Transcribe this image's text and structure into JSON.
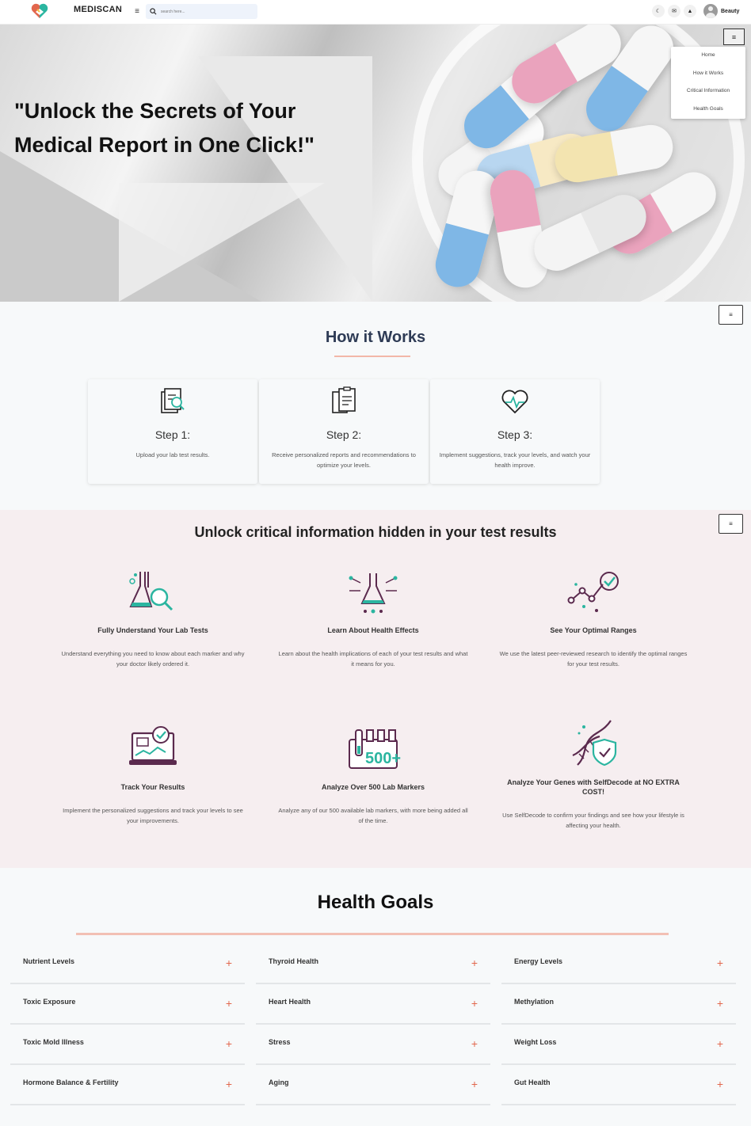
{
  "header": {
    "brand": "MEDISCAN",
    "menu_icon": "hamburger-icon",
    "search_placeholder": "search here...",
    "icons": [
      "moon-icon",
      "mail-icon",
      "bell-icon"
    ],
    "user_name": "Beauty"
  },
  "hero": {
    "title": "\"Unlock the Secrets of Your Medical Report in One Click!\"",
    "menu_button": "≡",
    "dropdown": [
      "Home",
      "How it Works",
      "Critical Information",
      "Health Goals"
    ]
  },
  "how_it_works": {
    "title": "How it Works",
    "menu_button": "≡",
    "steps": [
      {
        "title": "Step 1:",
        "desc": "Upload your lab test results.",
        "icon": "document-search-icon"
      },
      {
        "title": "Step 2:",
        "desc": "Receive personalized reports and recommendations to optimize your levels.",
        "icon": "clipboard-icon"
      },
      {
        "title": "Step 3:",
        "desc": "Implement suggestions, track your levels, and watch your health improve.",
        "icon": "heartbeat-icon"
      }
    ]
  },
  "unlock": {
    "title": "Unlock critical information hidden in your test results",
    "menu_button": "≡",
    "features": [
      {
        "title": "Fully Understand Your Lab Tests",
        "desc": "Understand everything you need to know about each marker and why your doctor likely ordered it.",
        "icon": "flask-magnifier-icon"
      },
      {
        "title": "Learn About Health Effects",
        "desc": "Learn about the health implications of each of your test results and what it means for you.",
        "icon": "flask-network-icon"
      },
      {
        "title": "See Your Optimal Ranges",
        "desc": "We use the latest peer-reviewed research to identify the optimal ranges for your test results.",
        "icon": "range-check-icon"
      },
      {
        "title": "Track Your Results",
        "desc": "Implement the personalized suggestions and track your levels to see your improvements.",
        "icon": "laptop-chart-icon"
      },
      {
        "title": "Analyze Over 500 Lab Markers",
        "desc": "Analyze any of our 500 available lab markers, with more being added all of the time.",
        "icon": "test-tubes-500-icon"
      },
      {
        "title": "Analyze Your Genes with SelfDecode at NO EXTRA COST!",
        "desc": "Use SelfDecode to confirm your findings and see how your lifestyle is affecting your health.",
        "icon": "dna-shield-icon"
      }
    ]
  },
  "health_goals": {
    "title": "Health Goals",
    "columns": [
      [
        "Nutrient Levels",
        "Toxic Exposure",
        "Toxic Mold Illness",
        "Hormone Balance & Fertility"
      ],
      [
        "Thyroid Health",
        "Heart Health",
        "Stress",
        "Aging"
      ],
      [
        "Energy Levels",
        "Methylation",
        "Weight Loss",
        "Gut Health"
      ]
    ],
    "expand_symbol": "+"
  },
  "colors": {
    "accent": "#e2674d",
    "teal": "#2bb5a0",
    "purple": "#5b2a4e",
    "underline": "#f2b7a8",
    "title_navy": "#2e3b55"
  }
}
